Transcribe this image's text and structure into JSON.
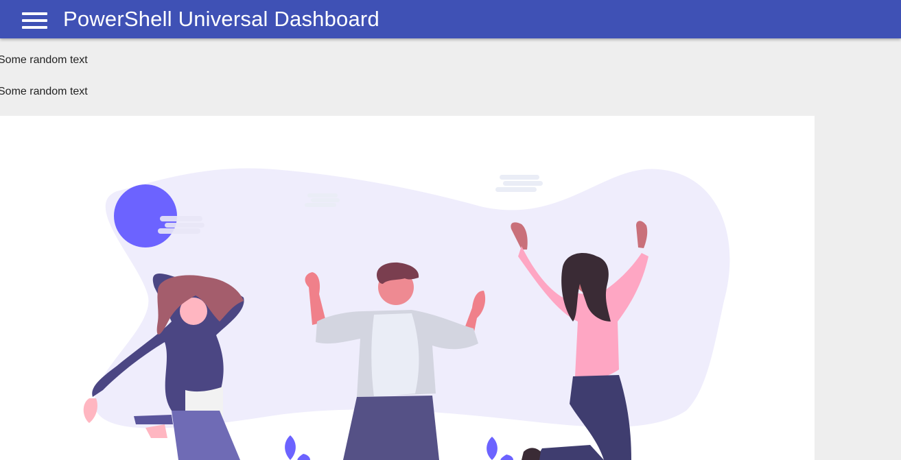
{
  "appbar": {
    "title": "PowerShell Universal Dashboard",
    "menu_icon": "hamburger-menu-icon",
    "background_color": "#3f51b5"
  },
  "content": {
    "texts": [
      "Some random text",
      "Some random text"
    ]
  },
  "illustration": {
    "icon": "people-celebrating-illustration",
    "accent_color": "#6c63ff",
    "blob_color": "#efedfc"
  }
}
